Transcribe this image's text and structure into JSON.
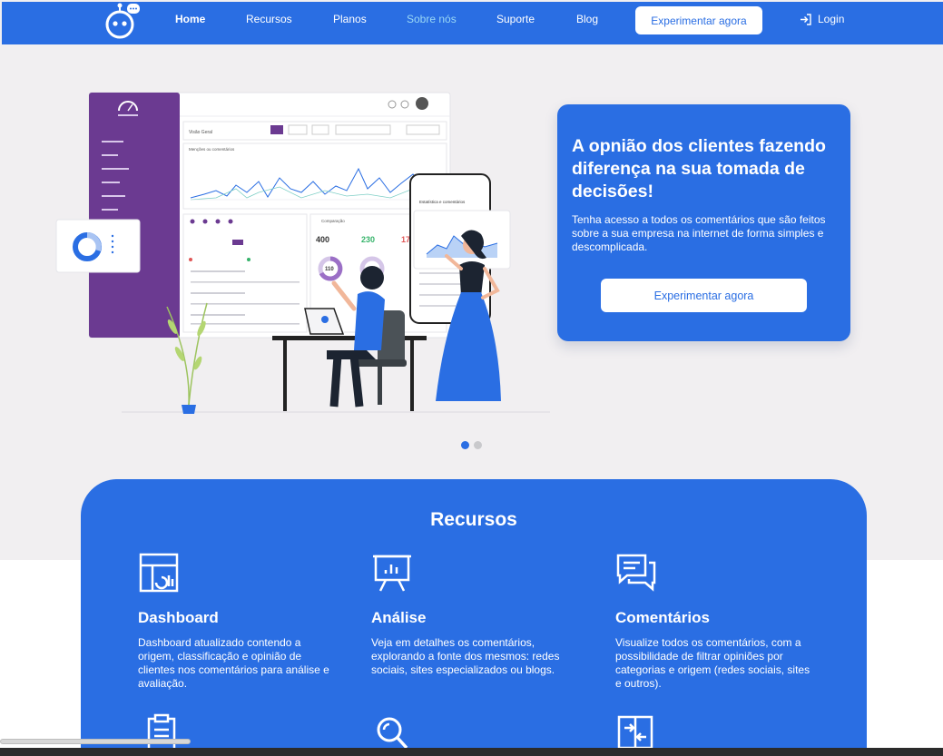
{
  "nav": {
    "links": [
      "Home",
      "Recursos",
      "Planos",
      "Sobre nós",
      "Suporte",
      "Blog"
    ],
    "cta": "Experimentar agora",
    "login": "Login",
    "logo_icon": "robot-icon",
    "login_icon": "login-arrow-icon"
  },
  "hero": {
    "title": "A opnião dos clientes fazendo diferença na sua tomada de decisões!",
    "text": "Tenha acesso a todos os comentários que são feitos sobre a sua empresa na internet de forma simples e descomplicada.",
    "button": "Experimentar agora",
    "carousel_index": 1,
    "carousel_count": 2
  },
  "illustration": {
    "dashboard_title": "Visão Geral",
    "dashboard_subtitle": "Menções ou comentários",
    "comparison": "Comparação",
    "stat_a": "400",
    "stat_b": "230",
    "stat_c": "17",
    "ring_a": "110",
    "phone_title": "Estatística e comentários"
  },
  "resources": {
    "title": "Recursos",
    "items": [
      {
        "icon": "dashboard-icon",
        "title": "Dashboard",
        "text": "Dashboard atualizado contendo a origem, classificação e opinião de clientes nos comentários para análise e avaliação."
      },
      {
        "icon": "presentation-chart-icon",
        "title": "Análise",
        "text": "Veja em detalhes os comentários, explorando a fonte dos mesmos: redes sociais, sites especializados ou blogs."
      },
      {
        "icon": "chat-bubbles-icon",
        "title": "Comentários",
        "text": "Visualize todos os comentários, com a possibilidade de filtrar opiniões por categorias e origem (redes sociais, sites e outros)."
      }
    ],
    "more_icons": [
      "clipboard-icon",
      "search-icon",
      "transfer-icon"
    ]
  },
  "colors": {
    "primary": "#2a6ee3",
    "background": "#f1eff1",
    "sidebar": "#6b3a91",
    "accent_link": "#9ad8f5"
  }
}
